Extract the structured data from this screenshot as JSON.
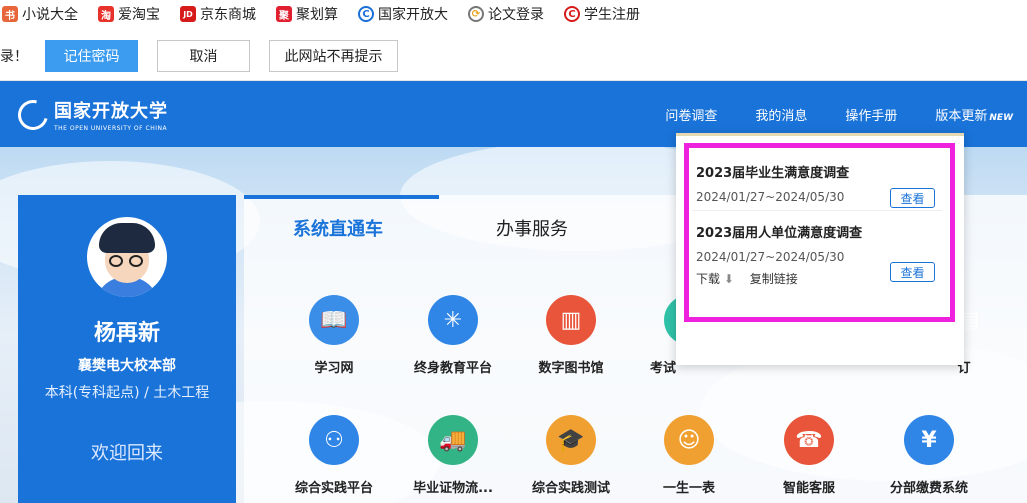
{
  "bookmarks": [
    {
      "label": "小说大全",
      "icon": "book-icon",
      "color": "#e8663c",
      "glyph": "书"
    },
    {
      "label": "爱淘宝",
      "icon": "taobao-icon",
      "color": "#e6322a",
      "glyph": "淘"
    },
    {
      "label": "京东商城",
      "icon": "jd-icon",
      "color": "#d71b1b",
      "glyph": "JD"
    },
    {
      "label": "聚划算",
      "icon": "juhuasuan-icon",
      "color": "#e0202f",
      "glyph": "聚"
    },
    {
      "label": "国家开放大",
      "icon": "ouchn-icon",
      "color": "#1a6fd8",
      "glyph": "C"
    },
    {
      "label": "论文登录",
      "icon": "paper-icon",
      "color": "#e8a21a",
      "glyph": "⟳"
    },
    {
      "label": "学生注册",
      "icon": "student-icon",
      "color": "#d71b1b",
      "glyph": "C"
    }
  ],
  "password_bar": {
    "message": "录！",
    "remember": "记住密码",
    "cancel": "取消",
    "never": "此网站不再提示"
  },
  "site": {
    "logo_cn": "国家开放大学",
    "logo_en": "THE OPEN UNIVERSITY OF CHINA",
    "nav": [
      {
        "label": "问卷调查",
        "name": "nav-survey"
      },
      {
        "label": "我的消息",
        "name": "nav-messages"
      },
      {
        "label": "操作手册",
        "name": "nav-manual"
      },
      {
        "label": "版本更新",
        "name": "nav-update"
      }
    ],
    "new_badge": "NEW"
  },
  "profile": {
    "name": "杨再新",
    "school": "襄樊电大校本部",
    "major": "本科(专科起点) / 土木工程",
    "welcome": "欢迎回来"
  },
  "tabs": {
    "system": "系统直通车",
    "service": "办事服务"
  },
  "apps_row1": [
    {
      "label": "学习网",
      "color": "#3a8ee8",
      "glyph": "📖"
    },
    {
      "label": "终身教育平台",
      "color": "#2f86e6",
      "glyph": "✳"
    },
    {
      "label": "数字图书馆",
      "color": "#e8553a",
      "glyph": "▥"
    },
    {
      "label": "考试",
      "color": "#30c2a8",
      "glyph": "✎"
    },
    {
      "label": "订",
      "color": "#f0a030",
      "glyph": "▤"
    }
  ],
  "apps_row2": [
    {
      "label": "综合实践平台",
      "color": "#2f86e6",
      "glyph": "⚇"
    },
    {
      "label": "毕业证物流...",
      "color": "#33b487",
      "glyph": "🚚"
    },
    {
      "label": "综合实践测试",
      "color": "#f0a030",
      "glyph": "🎓"
    },
    {
      "label": "一生一表",
      "color": "#f0a030",
      "glyph": "☺"
    },
    {
      "label": "智能客服",
      "color": "#e8553a",
      "glyph": "☎"
    },
    {
      "label": "分部缴费系统",
      "color": "#2f86e6",
      "glyph": "¥"
    }
  ],
  "surveys": [
    {
      "title": "2023届毕业生满意度调查",
      "date": "2024/01/27~2024/05/30",
      "view": "查看"
    },
    {
      "title": "2023届用人单位满意度调查",
      "date": "2024/01/27~2024/05/30",
      "view": "查看",
      "download": "下载",
      "copy": "复制链接"
    }
  ]
}
